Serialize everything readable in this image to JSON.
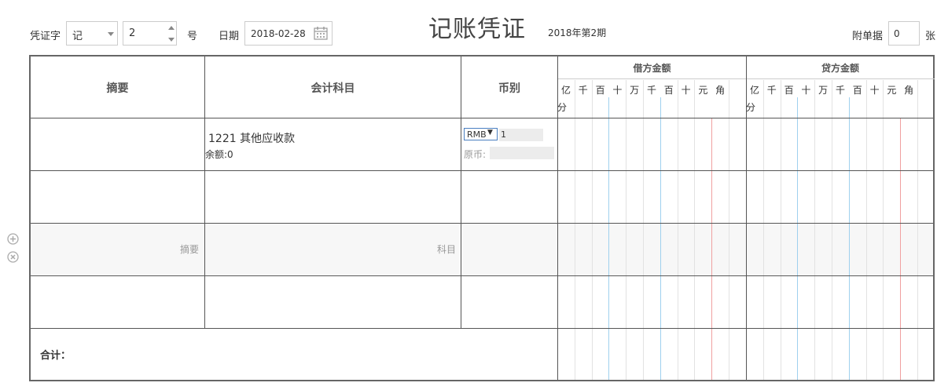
{
  "toolbar": {
    "voucher_word_label": "凭证字",
    "voucher_word_value": "记",
    "number_value": "2",
    "number_suffix": "号",
    "date_label": "日期",
    "date_value": "2018-02-28",
    "title": "记账凭证",
    "period": "2018年第2期",
    "attachment_label": "附单据",
    "attachment_value": "0",
    "attachment_suffix": "张"
  },
  "table": {
    "headers": {
      "summary": "摘要",
      "account": "会计科目",
      "currency": "币别",
      "debit": "借方金额",
      "credit": "贷方金额"
    },
    "digit_units": [
      "亿",
      "千",
      "百",
      "十",
      "万",
      "千",
      "百",
      "十",
      "元",
      "角",
      "分"
    ],
    "rows": [
      {
        "summary": "",
        "account_code": "1221 其他应收款",
        "balance": "余额:0",
        "currency_code": "RMB",
        "rate": "1",
        "original_label": "原币:"
      },
      {
        "summary": "",
        "account_code": ""
      },
      {
        "summary_placeholder": "摘要",
        "account_placeholder": "科目"
      },
      {
        "summary": "",
        "account_code": ""
      }
    ],
    "total_label": "合计："
  },
  "colors": {
    "border": "#555555",
    "blue_line": "#9fd0ee",
    "red_line": "#f0a0a0",
    "shade": "#f7f7f7"
  },
  "icons": {
    "add": "plus-circle-icon",
    "remove": "x-circle-icon",
    "date": "calendar-icon"
  }
}
